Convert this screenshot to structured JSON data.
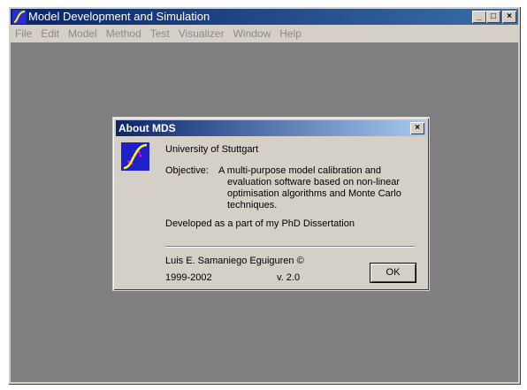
{
  "window": {
    "title": "Model Development and Simulation",
    "controls": {
      "minimize": "_",
      "maximize": "□",
      "close": "×"
    }
  },
  "menu": [
    "File",
    "Edit",
    "Model",
    "Method",
    "Test",
    "Visualizer",
    "Window",
    "Help"
  ],
  "dialog": {
    "title": "About MDS",
    "university": "University of Stuttgart",
    "objective_label": "Objective:",
    "objective_lines": [
      "A multi-purpose model calibration and",
      "evaluation software based on non-linear",
      "optimisation algorithms and Monte Carlo",
      "techniques."
    ],
    "developed": "Developed as a part of my PhD Dissertation",
    "author": "Luis E. Samaniego Eguiguren ©",
    "years": "1999-2002",
    "version": "v. 2.0",
    "ok_label": "OK"
  },
  "colors": {
    "titlebar": "#0a246a",
    "workspace": "#808080",
    "face": "#d4d0c8"
  }
}
